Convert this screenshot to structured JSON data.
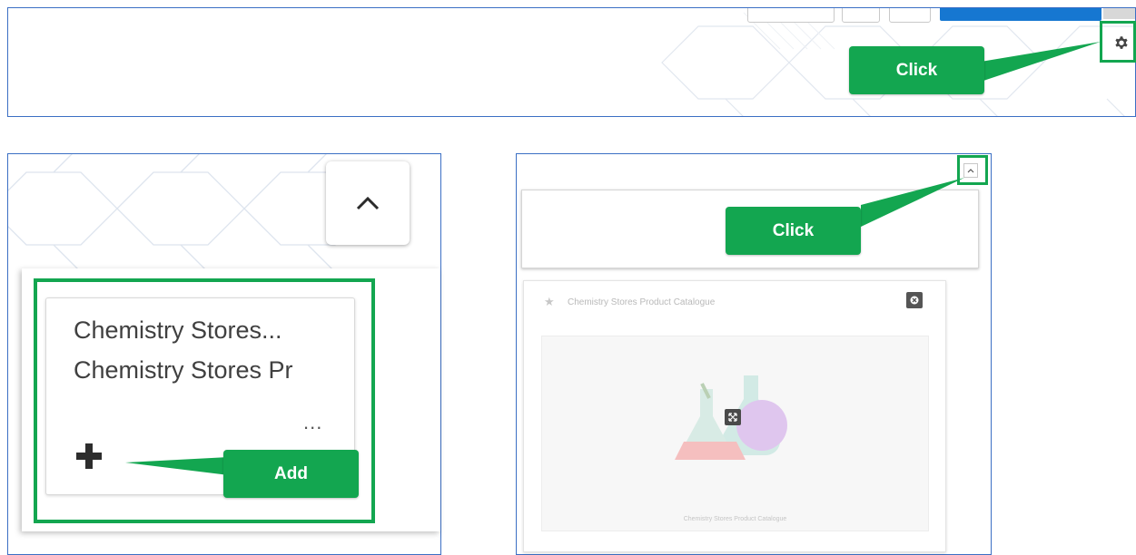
{
  "callouts": {
    "settings_click": "Click",
    "collapse_click": "Click",
    "add": "Add"
  },
  "menu": {
    "items": [
      "Chemistry Stores...",
      "Chemistry Stores Pr"
    ],
    "more_label": "...",
    "add_icon": "plus-icon"
  },
  "widget": {
    "title": "Chemistry Stores Product Catalogue",
    "tile_caption": "Chemistry Stores Product Catalogue",
    "icons": [
      "star-icon",
      "close-icon",
      "expand-icon",
      "flask-icon"
    ]
  },
  "icons": {
    "settings": "gear-icon",
    "chevron": "chevron-up-icon",
    "collapse": "collapse-icon"
  },
  "colors": {
    "callout": "#13a650",
    "panel_border": "#3b6fc4",
    "toolbar_button": "#1677d1"
  }
}
